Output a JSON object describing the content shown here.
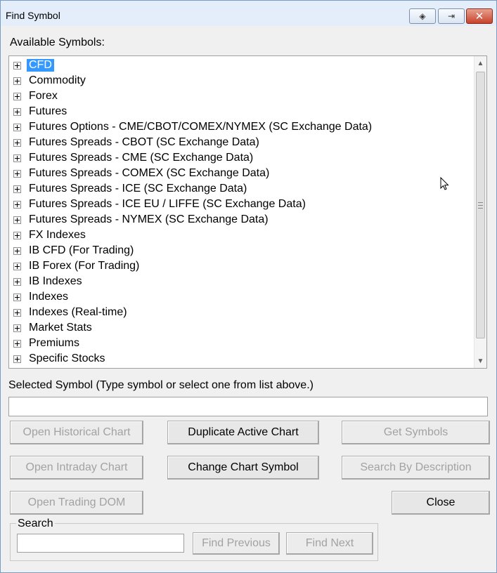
{
  "window": {
    "title": "Find Symbol"
  },
  "titlebar_buttons": [
    {
      "name": "pin-icon",
      "glyph": "◈"
    },
    {
      "name": "restore-icon",
      "glyph": "⇥"
    },
    {
      "name": "close-icon",
      "glyph": "✕"
    }
  ],
  "available_label": "Available Symbols:",
  "tree": {
    "items": [
      {
        "label": "CFD",
        "selected": true
      },
      {
        "label": "Commodity"
      },
      {
        "label": "Forex"
      },
      {
        "label": "Futures"
      },
      {
        "label": "Futures Options - CME/CBOT/COMEX/NYMEX (SC Exchange Data)"
      },
      {
        "label": "Futures Spreads - CBOT (SC Exchange Data)"
      },
      {
        "label": "Futures Spreads - CME (SC Exchange Data)"
      },
      {
        "label": "Futures Spreads - COMEX (SC Exchange Data)"
      },
      {
        "label": "Futures Spreads - ICE (SC Exchange Data)"
      },
      {
        "label": "Futures Spreads - ICE EU / LIFFE (SC Exchange Data)"
      },
      {
        "label": "Futures Spreads - NYMEX (SC Exchange Data)"
      },
      {
        "label": "FX Indexes"
      },
      {
        "label": "IB CFD (For Trading)"
      },
      {
        "label": "IB Forex (For Trading)"
      },
      {
        "label": "IB Indexes"
      },
      {
        "label": "Indexes"
      },
      {
        "label": "Indexes (Real-time)"
      },
      {
        "label": "Market Stats"
      },
      {
        "label": "Premiums"
      },
      {
        "label": "Specific Stocks"
      }
    ]
  },
  "selected_symbol": {
    "label": "Selected Symbol (Type symbol or select one from list above.)",
    "value": ""
  },
  "buttons": {
    "open_historical": "Open Historical Chart",
    "duplicate_active": "Duplicate Active Chart",
    "get_symbols": "Get Symbols",
    "open_intraday": "Open Intraday Chart",
    "change_symbol": "Change Chart Symbol",
    "search_by_description": "Search By Description",
    "open_dom": "Open Trading DOM",
    "close": "Close"
  },
  "search": {
    "group_label": "Search",
    "value": "",
    "find_previous": "Find Previous",
    "find_next": "Find Next"
  }
}
